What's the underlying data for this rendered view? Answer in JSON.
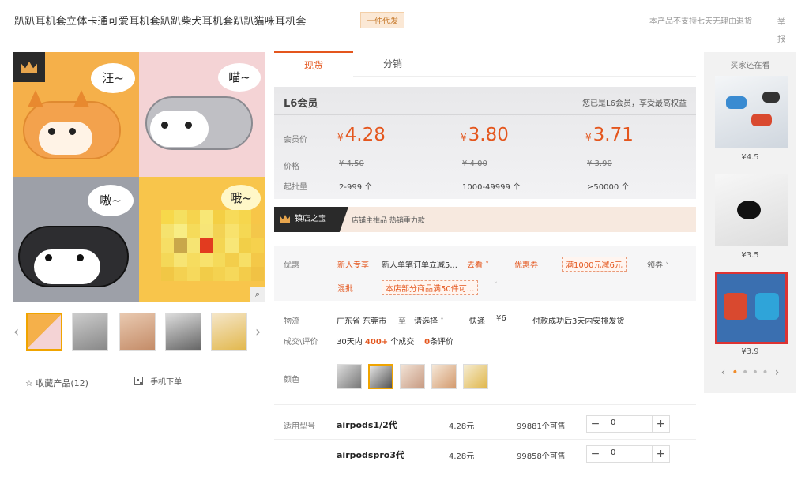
{
  "header": {
    "title": "趴趴耳机套立体卡通可爱耳机套趴趴柴犬耳机套趴趴猫咪耳机套",
    "badge": "一件代发",
    "no_return_notice": "本产品不支持七天无理由退货",
    "report": "举报"
  },
  "gallery": {
    "bubbles": [
      "汪~",
      "喵~",
      "嗷~",
      "哦~"
    ],
    "zoom_icon": "zoom-icon",
    "prev_arrow": "‹",
    "next_arrow": "›",
    "thumbnail_count": 5,
    "selected_thumbnail": 0
  },
  "actions": {
    "favorite_label": "收藏产品(12)",
    "mobile_order_label": "手机下单"
  },
  "tabs": [
    {
      "label": "现货",
      "active": true
    },
    {
      "label": "分销",
      "active": false
    }
  ],
  "member": {
    "level": "L6会员",
    "note": "您已是L6会员，享受最高权益",
    "member_price_label": "会员价",
    "price_label": "价格",
    "moq_label": "起批量",
    "currency": "¥",
    "tiers": [
      {
        "member_price": "4.28",
        "price": "¥ 4.50",
        "qty": "2-999 个"
      },
      {
        "member_price": "3.80",
        "price": "¥ 4.00",
        "qty": "1000-49999 个"
      },
      {
        "member_price": "3.71",
        "price": "¥ 3.90",
        "qty": "≥50000 个"
      }
    ]
  },
  "store": {
    "badge": "镇店之宝",
    "text": "店铺主推品 热销重力款"
  },
  "promo": {
    "label": "优惠",
    "newcomer_label": "新人专享",
    "newcomer_text": "新人单笔订单立减5...",
    "newcomer_link": "去看 ˅",
    "coupon_label": "优惠券",
    "coupon_text": "满1000元减6元",
    "claim_label": "领券",
    "mix_label": "混批",
    "mix_text": "本店部分商品满50件可..."
  },
  "logistics": {
    "label": "物流",
    "from": "广东省 东莞市",
    "to_word": "至",
    "dest": "请选择",
    "express": "快递",
    "fee": "¥6",
    "ship_note": "付款成功后3天内安排发货"
  },
  "deals": {
    "label": "成交\\评价",
    "prefix": "30天内",
    "count": "400+",
    "suffix": "个成交",
    "reviews": "0",
    "reviews_suffix": "条评价"
  },
  "colors": {
    "label": "颜色",
    "count": 5,
    "selected": 1
  },
  "models": {
    "label": "适用型号",
    "rows": [
      {
        "name": "airpods1/2代",
        "price": "4.28元",
        "stock": "99881个可售",
        "qty": "0",
        "minus": "−",
        "plus": "+"
      },
      {
        "name": "airpodspro3代",
        "price": "4.28元",
        "stock": "99858个可售",
        "qty": "0",
        "minus": "−",
        "plus": "+"
      }
    ]
  },
  "recommend": {
    "title": "买家还在看",
    "items": [
      {
        "price": "¥4.5"
      },
      {
        "price": "¥3.5"
      },
      {
        "price": "¥3.9"
      }
    ],
    "prev": "‹",
    "next": "›"
  },
  "theme": {
    "accent": "#e4561d",
    "highlight_border": "#f0a400"
  }
}
